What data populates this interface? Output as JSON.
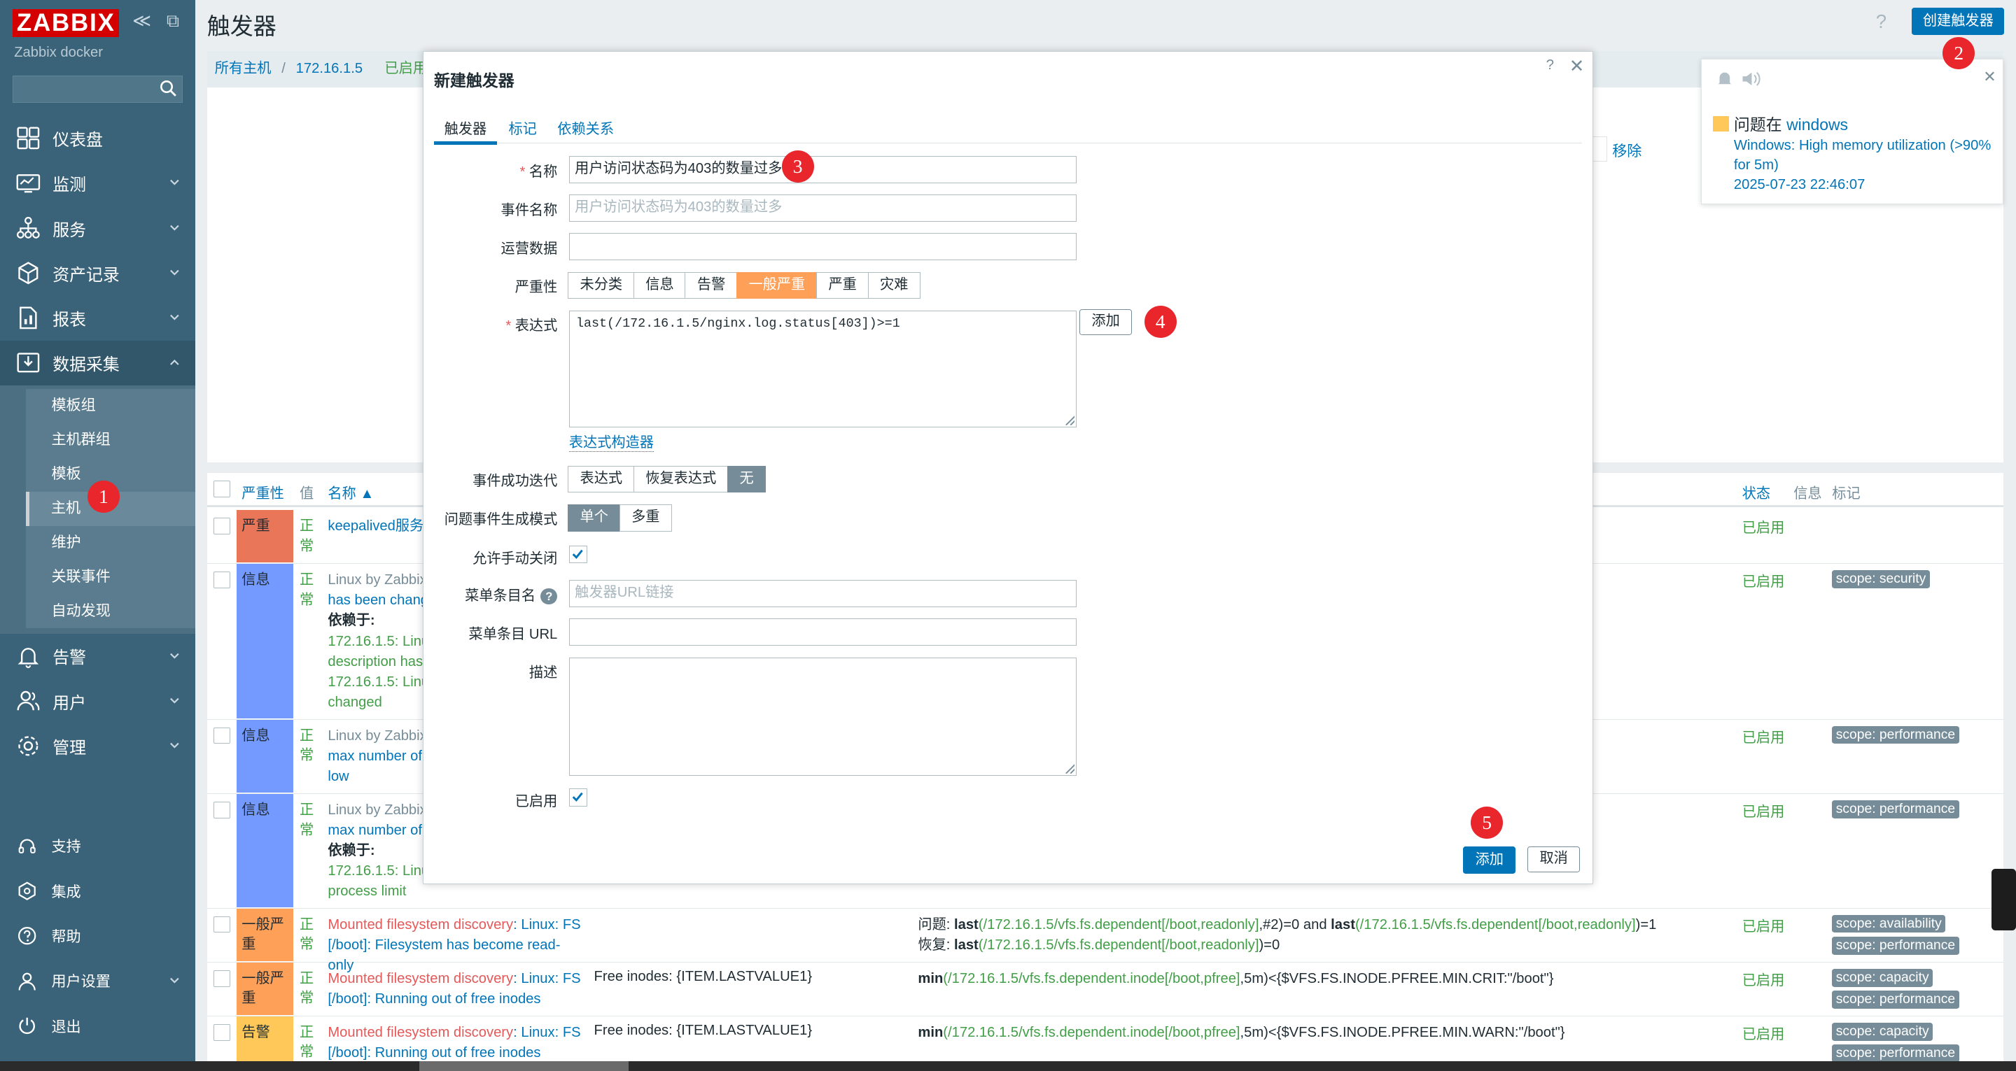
{
  "app": {
    "logo": "ZABBIX",
    "subtitle": "Zabbix docker",
    "page_title": "触发器",
    "help": "?",
    "create_button": "创建触发器"
  },
  "sidebar": {
    "tools": "≪ ⧉",
    "main": [
      {
        "label": "仪表盘",
        "icon": "dashboard-icon"
      },
      {
        "label": "监测",
        "icon": "monitoring-icon"
      },
      {
        "label": "服务",
        "icon": "services-icon"
      },
      {
        "label": "资产记录",
        "icon": "inventory-icon"
      },
      {
        "label": "报表",
        "icon": "reports-icon"
      },
      {
        "label": "数据采集",
        "icon": "data-collection-icon"
      }
    ],
    "sub": [
      "模板组",
      "主机群组",
      "模板",
      "主机",
      "维护",
      "关联事件",
      "自动发现"
    ],
    "after": [
      {
        "label": "告警",
        "icon": "alerts-icon"
      },
      {
        "label": "用户",
        "icon": "users-icon"
      },
      {
        "label": "管理",
        "icon": "administration-icon"
      }
    ],
    "bottom": [
      {
        "label": "支持",
        "icon": "support-icon"
      },
      {
        "label": "集成",
        "icon": "integrations-icon"
      },
      {
        "label": "帮助",
        "icon": "help-icon"
      },
      {
        "label": "用户设置",
        "icon": "user-settings-icon"
      },
      {
        "label": "退出",
        "icon": "signout-icon"
      }
    ]
  },
  "breadcrumb": {
    "all_hosts": "所有主机",
    "sep": "/",
    "host": "172.16.1.5",
    "enabled": "已启用"
  },
  "filter": {
    "remove": "移除"
  },
  "table": {
    "headers": {
      "severity": "严重性",
      "value": "值",
      "name": "名称 ▲",
      "status": "状态",
      "info": "信息",
      "tags": "标记"
    },
    "rows": [
      {
        "severity": "严重",
        "sev_color": "#e97659",
        "value": "正常",
        "name_lines": [
          "keepalived服务宕"
        ],
        "status": "已启用",
        "tags": []
      },
      {
        "severity": "信息",
        "sev_color": "#7499ff",
        "value": "正常",
        "n1": "Linux by Zabbix",
        "n2": "has been chang",
        "n3": "依赖于:",
        "n4": "172.16.1.5: Linu",
        "n5": "description has",
        "n6": "172.16.1.5: Linu",
        "n7": "changed",
        "status": "已启用",
        "tag1": "scope: security"
      },
      {
        "severity": "信息",
        "sev_color": "#7499ff",
        "value": "正常",
        "n1": "Linux by Zabbix",
        "n2": "max number of",
        "n3": "low",
        "status": "已启用",
        "tag1": "scope: performance"
      },
      {
        "severity": "信息",
        "sev_color": "#7499ff",
        "value": "正常",
        "n1": "Linux by Zabbix",
        "n2": "max number of",
        "n3": "依赖于:",
        "n4": "172.16.1.5: Linu",
        "n5": "process limit",
        "status": "已启用",
        "tag1": "scope: performance"
      },
      {
        "severity": "一般严重",
        "sev_color": "#ffa059",
        "value": "正常",
        "n1": "Mounted filesystem discovery",
        "n1b": ": Linux: FS",
        "n2": "[/boot]: Filesystem has become read-only",
        "e1a": "问题: ",
        "e1b": "last",
        "e1c": "(/172.16.1.5/vfs.fs.dependent[/boot,readonly]",
        "e1d": ",#2)=0 and ",
        "e1e": "last",
        "e1f": "(/172.16.1.5/vfs.fs.dependent[/boot,readonly]",
        "e1g": ")=1",
        "e2a": "恢复: ",
        "e2b": "last",
        "e2c": "(/172.16.1.5/vfs.fs.dependent[/boot,readonly]",
        "e2d": ")=0",
        "status": "已启用",
        "tag1": "scope: availability",
        "tag2": "scope: performance"
      },
      {
        "severity": "一般严重",
        "sev_color": "#ffa059",
        "value": "正常",
        "n1": "Mounted filesystem discovery",
        "n1b": ": Linux: FS",
        "n2": "[/boot]: Running out of free inodes",
        "op": "Free inodes: {ITEM.LASTVALUE1}",
        "e1b": "min",
        "e1c": "(/172.16.1.5/vfs.fs.dependent.inode[/boot,pfree]",
        "e1d": ",5m)<{$VFS.FS.INODE.PFREE.MIN.CRIT:\"/boot\"}",
        "status": "已启用",
        "tag1": "scope: capacity",
        "tag2": "scope: performance"
      },
      {
        "severity": "告警",
        "sev_color": "#ffc859",
        "value": "正常",
        "n1": "Mounted filesystem discovery",
        "n1b": ": Linux: FS",
        "n2": "[/boot]: Running out of free inodes",
        "op": "Free inodes: {ITEM.LASTVALUE1}",
        "e1b": "min",
        "e1c": "(/172.16.1.5/vfs.fs.dependent.inode[/boot,pfree]",
        "e1d": ",5m)<{$VFS.FS.INODE.PFREE.MIN.WARN:\"/boot\"}",
        "status": "已启用",
        "tag1": "scope: capacity",
        "tag2": "scope: performance"
      }
    ]
  },
  "modal": {
    "title": "新建触发器",
    "help": "?",
    "close": "✕",
    "tabs": [
      "触发器",
      "标记",
      "依赖关系"
    ],
    "labels": {
      "name": "名称",
      "event_name": "事件名称",
      "opdata": "运营数据",
      "severity": "严重性",
      "expression": "表达式",
      "recovery": "事件成功迭代",
      "problem_mode": "问题事件生成模式",
      "manual_close": "允许手动关闭",
      "url_name": "菜单条目名",
      "url": "菜单条目 URL",
      "description": "描述",
      "enabled": "已启用"
    },
    "required_mark": "*",
    "name_value": "用户访问状态码为403的数量过多",
    "event_name_placeholder": "用户访问状态码为403的数量过多",
    "url_name_placeholder": "触发器URL链接",
    "severities": [
      "未分类",
      "信息",
      "告警",
      "一般严重",
      "严重",
      "灾难"
    ],
    "severity_selected": "一般严重",
    "expression_value": "last(/172.16.1.5/nginx.log.status[403])>=1",
    "add_expr_button": "添加",
    "expr_builder_link": "表达式构造器",
    "recovery_options": [
      "表达式",
      "恢复表达式",
      "无"
    ],
    "recovery_selected": "无",
    "problem_modes": [
      "单个",
      "多重"
    ],
    "problem_mode_selected": "单个",
    "qmark": "?",
    "add_button": "添加",
    "cancel_button": "取消"
  },
  "notification": {
    "title_prefix": "问题在",
    "host": "windows",
    "message": "Windows: High memory utilization (>90% for 5m)",
    "time": "2025-07-23 22:46:07",
    "close": "✕",
    "severity_color": "#ffc859"
  },
  "markers": [
    "1",
    "2",
    "3",
    "4",
    "5"
  ]
}
